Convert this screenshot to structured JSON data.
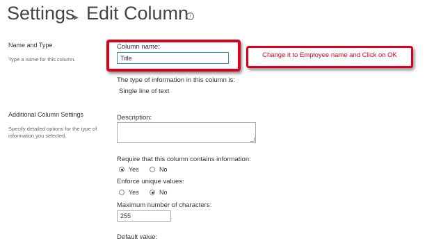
{
  "header": {
    "settings_label": "Settings",
    "separator": "▸",
    "page_title": "Edit Column",
    "info_symbol": "i"
  },
  "name_and_type": {
    "title": "Name and Type",
    "description": "Type a name for this column.",
    "column_name_label": "Column name:",
    "column_name_value": "Title",
    "type_info_label": "The type of information in this column is:",
    "type_value": "Single line of text"
  },
  "annotation": {
    "text": "Change it to Employee name and Click on OK",
    "color": "#d9001b"
  },
  "additional": {
    "title": "Additional Column Settings",
    "description": "Specify detailed options for the type of information you selected.",
    "description_label": "Description:",
    "required_label": "Require that this column contains information:",
    "required_options": [
      {
        "label": "Yes",
        "checked": true
      },
      {
        "label": "No",
        "checked": false
      }
    ],
    "unique_label": "Enforce unique values:",
    "unique_options": [
      {
        "label": "Yes",
        "checked": false
      },
      {
        "label": "No",
        "checked": true
      }
    ],
    "max_chars_label": "Maximum number of characters:",
    "max_chars_value": "255",
    "default_value_label": "Default value:"
  }
}
